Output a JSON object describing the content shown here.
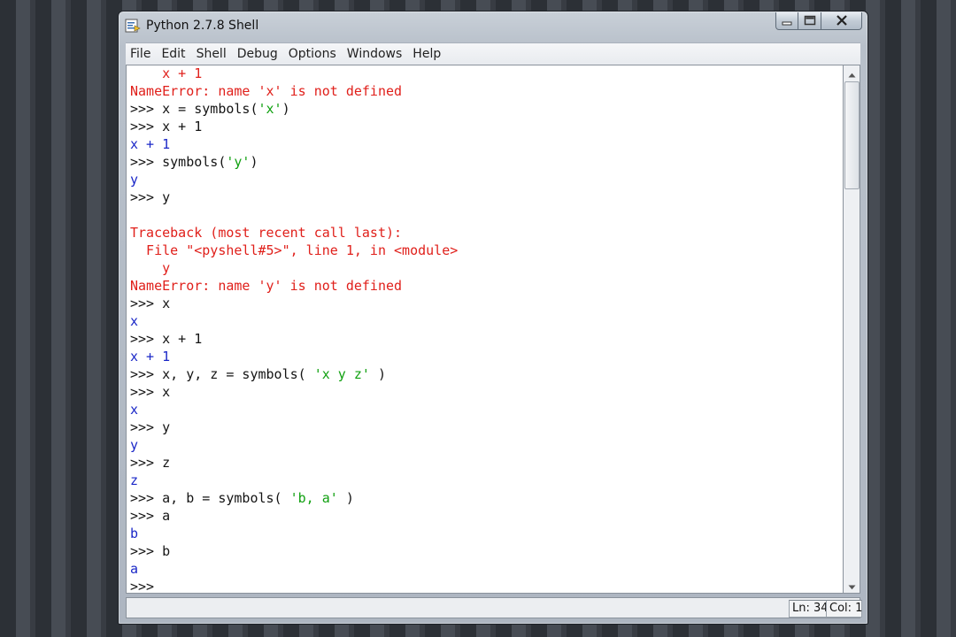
{
  "window": {
    "title": "Python 2.7.8 Shell"
  },
  "icons": {
    "app": "python-idle-icon",
    "minimize": "minimize-icon",
    "maximize": "maximize-icon",
    "close": "close-icon",
    "scroll_up": "arrow-up-icon",
    "scroll_down": "arrow-down-icon"
  },
  "menu": [
    "File",
    "Edit",
    "Shell",
    "Debug",
    "Options",
    "Windows",
    "Help"
  ],
  "shell_lines": [
    [
      {
        "t": "    x + 1",
        "c": "err"
      }
    ],
    [
      {
        "t": "NameError: name 'x' is not defined",
        "c": "err"
      }
    ],
    [
      {
        "t": ">>> ",
        "c": "prompt"
      },
      {
        "t": "x = symbols(",
        "c": "code"
      },
      {
        "t": "'x'",
        "c": "str"
      },
      {
        "t": ")",
        "c": "code"
      }
    ],
    [
      {
        "t": ">>> ",
        "c": "prompt"
      },
      {
        "t": "x + 1",
        "c": "code"
      }
    ],
    [
      {
        "t": "x + 1",
        "c": "out"
      }
    ],
    [
      {
        "t": ">>> ",
        "c": "prompt"
      },
      {
        "t": "symbols(",
        "c": "code"
      },
      {
        "t": "'y'",
        "c": "str"
      },
      {
        "t": ")",
        "c": "code"
      }
    ],
    [
      {
        "t": "y",
        "c": "out"
      }
    ],
    [
      {
        "t": ">>> ",
        "c": "prompt"
      },
      {
        "t": "y",
        "c": "code"
      }
    ],
    [
      {
        "t": "",
        "c": "code"
      }
    ],
    [
      {
        "t": "Traceback (most recent call last):",
        "c": "err"
      }
    ],
    [
      {
        "t": "  File \"<pyshell#5>\", line 1, in <module>",
        "c": "err"
      }
    ],
    [
      {
        "t": "    y",
        "c": "err"
      }
    ],
    [
      {
        "t": "NameError: name 'y' is not defined",
        "c": "err"
      }
    ],
    [
      {
        "t": ">>> ",
        "c": "prompt"
      },
      {
        "t": "x",
        "c": "code"
      }
    ],
    [
      {
        "t": "x",
        "c": "out"
      }
    ],
    [
      {
        "t": ">>> ",
        "c": "prompt"
      },
      {
        "t": "x + 1",
        "c": "code"
      }
    ],
    [
      {
        "t": "x + 1",
        "c": "out"
      }
    ],
    [
      {
        "t": ">>> ",
        "c": "prompt"
      },
      {
        "t": "x, y, z = symbols( ",
        "c": "code"
      },
      {
        "t": "'x y z'",
        "c": "str"
      },
      {
        "t": " )",
        "c": "code"
      }
    ],
    [
      {
        "t": ">>> ",
        "c": "prompt"
      },
      {
        "t": "x",
        "c": "code"
      }
    ],
    [
      {
        "t": "x",
        "c": "out"
      }
    ],
    [
      {
        "t": ">>> ",
        "c": "prompt"
      },
      {
        "t": "y",
        "c": "code"
      }
    ],
    [
      {
        "t": "y",
        "c": "out"
      }
    ],
    [
      {
        "t": ">>> ",
        "c": "prompt"
      },
      {
        "t": "z",
        "c": "code"
      }
    ],
    [
      {
        "t": "z",
        "c": "out"
      }
    ],
    [
      {
        "t": ">>> ",
        "c": "prompt"
      },
      {
        "t": "a, b = symbols( ",
        "c": "code"
      },
      {
        "t": "'b, a'",
        "c": "str"
      },
      {
        "t": " )",
        "c": "code"
      }
    ],
    [
      {
        "t": ">>> ",
        "c": "prompt"
      },
      {
        "t": "a",
        "c": "code"
      }
    ],
    [
      {
        "t": "b",
        "c": "out"
      }
    ],
    [
      {
        "t": ">>> ",
        "c": "prompt"
      },
      {
        "t": "b",
        "c": "code"
      }
    ],
    [
      {
        "t": "a",
        "c": "out"
      }
    ],
    [
      {
        "t": ">>> ",
        "c": "prompt"
      }
    ]
  ],
  "status": {
    "ln": "Ln: 34",
    "col": "Col: 1"
  },
  "colors": {
    "error": "#e0201b",
    "output": "#1a27c7",
    "string": "#10a010",
    "prompt": "#141414"
  }
}
